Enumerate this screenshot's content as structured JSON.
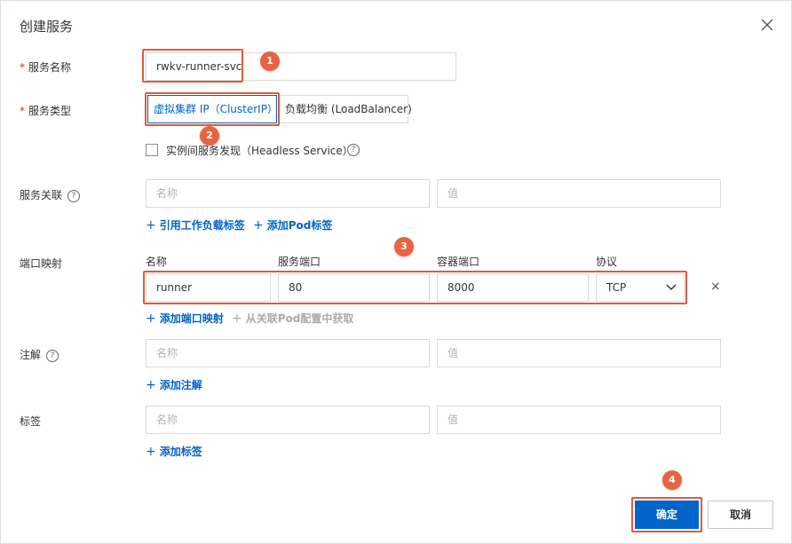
{
  "dialog": {
    "title": "创建服务"
  },
  "form": {
    "service_name": {
      "required_mark": "*",
      "label": "服务名称",
      "value": "rwkv-runner-svc"
    },
    "service_type": {
      "required_mark": "*",
      "label": "服务类型",
      "options": [
        "虚拟集群 IP（ClusterIP）",
        "负载均衡 (LoadBalancer)"
      ],
      "selected": "虚拟集群 IP（ClusterIP）",
      "headless_label": "实例间服务发现（Headless Service）",
      "headless_checked": false
    },
    "selector": {
      "label": "服务关联",
      "name_placeholder": "名称",
      "value_placeholder": "值",
      "link_workload": "引用工作负载标签",
      "link_pod": "添加Pod标签"
    },
    "ports": {
      "label": "端口映射",
      "col_name": "名称",
      "col_service_port": "服务端口",
      "col_container_port": "容器端口",
      "col_protocol": "协议",
      "rows": [
        {
          "name": "runner",
          "service_port": "80",
          "container_port": "8000",
          "protocol": "TCP"
        }
      ],
      "link_add": "添加端口映射",
      "link_from_pod": "从关联Pod配置中获取"
    },
    "annotations": {
      "label": "注解",
      "name_placeholder": "名称",
      "value_placeholder": "值",
      "link_add": "添加注解"
    },
    "labels": {
      "label": "标签",
      "name_placeholder": "名称",
      "value_placeholder": "值",
      "link_add": "添加标签"
    }
  },
  "footer": {
    "confirm": "确定",
    "cancel": "取消"
  },
  "callouts": [
    "1",
    "2",
    "3",
    "4"
  ],
  "glyphs": {
    "plus": "+",
    "help": "?",
    "row_delete": "×"
  },
  "colors": {
    "primary": "#0064c8",
    "callout": "#e8633f",
    "required": "#d93026"
  }
}
